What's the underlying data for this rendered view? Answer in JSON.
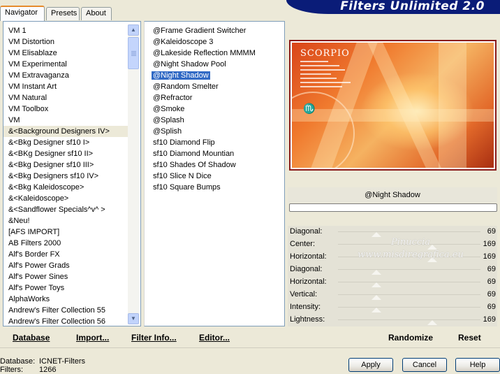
{
  "tabs": [
    "Navigator",
    "Presets",
    "About"
  ],
  "banner_title": "Filters Unlimited 2.0",
  "categories": [
    "VM 1",
    "VM Distortion",
    "VM Elisablaze",
    "VM Experimental",
    "VM Extravaganza",
    "VM Instant Art",
    "VM Natural",
    "VM Toolbox",
    "VM",
    "&<Background Designers IV>",
    "&<Bkg Designer sf10 I>",
    "&<BKg Designer sf10 II>",
    "&<Bkg Designer sf10 III>",
    "&<Bkg Designers sf10 IV>",
    "&<Bkg Kaleidoscope>",
    "&<Kaleidoscope>",
    "&<Sandflower Specials^v^ >",
    "&Neu!",
    "[AFS IMPORT]",
    "AB Filters 2000",
    "Alf's Border FX",
    "Alf's Power Grads",
    "Alf's Power Sines",
    "Alf's Power Toys",
    "AlphaWorks",
    "Andrew's Filter Collection 55",
    "Andrew's Filter Collection 56"
  ],
  "selected_category": "&<Background Designers IV>",
  "filters": [
    "@Frame Gradient Switcher",
    "@Kaleidoscope 3",
    "@Lakeside Reflection MMMM",
    "@Night Shadow Pool",
    "@Night Shadow",
    "@Random Smelter",
    "@Refractor",
    "@Smoke",
    "@Splash",
    "@Splish",
    "sf10 Diamond Flip",
    "sf10 Diamond Mountian",
    "sf10 Shades Of Shadow",
    "sf10 Slice N Dice",
    "sf10 Square Bumps"
  ],
  "selected_filter": "@Night Shadow",
  "preview": {
    "title": "SCORPIO",
    "glyph": "♏"
  },
  "current_filter_name": "@Night Shadow",
  "params": [
    {
      "label": "Diagonal:",
      "value": "69",
      "level": 0.27
    },
    {
      "label": "Center:",
      "value": "169",
      "level": 0.66
    },
    {
      "label": "Horizontal:",
      "value": "169",
      "level": 0.66
    },
    {
      "label": "Diagonal:",
      "value": "69",
      "level": 0.27
    },
    {
      "label": "Horizontal:",
      "value": "69",
      "level": 0.27
    },
    {
      "label": "Vertical:",
      "value": "69",
      "level": 0.27
    },
    {
      "label": "Intensity:",
      "value": "69",
      "level": 0.27
    },
    {
      "label": "Lightness:",
      "value": "169",
      "level": 0.66
    }
  ],
  "watermark": [
    "Pinuccia",
    "www.misdiregrafica.eu"
  ],
  "toolbar": {
    "database": "Database",
    "import": "Import...",
    "filter_info": "Filter Info...",
    "editor": "Editor...",
    "randomize": "Randomize",
    "reset": "Reset"
  },
  "status": {
    "database_label": "Database:",
    "database_value": "ICNET-Filters",
    "filters_label": "Filters:",
    "filters_value": "1266"
  },
  "buttons": {
    "apply": "Apply",
    "cancel": "Cancel",
    "help": "Help"
  },
  "colors": {
    "selection": "#316AC5",
    "banner": "#0A1C78",
    "tab_accent": "#E68B2C"
  }
}
